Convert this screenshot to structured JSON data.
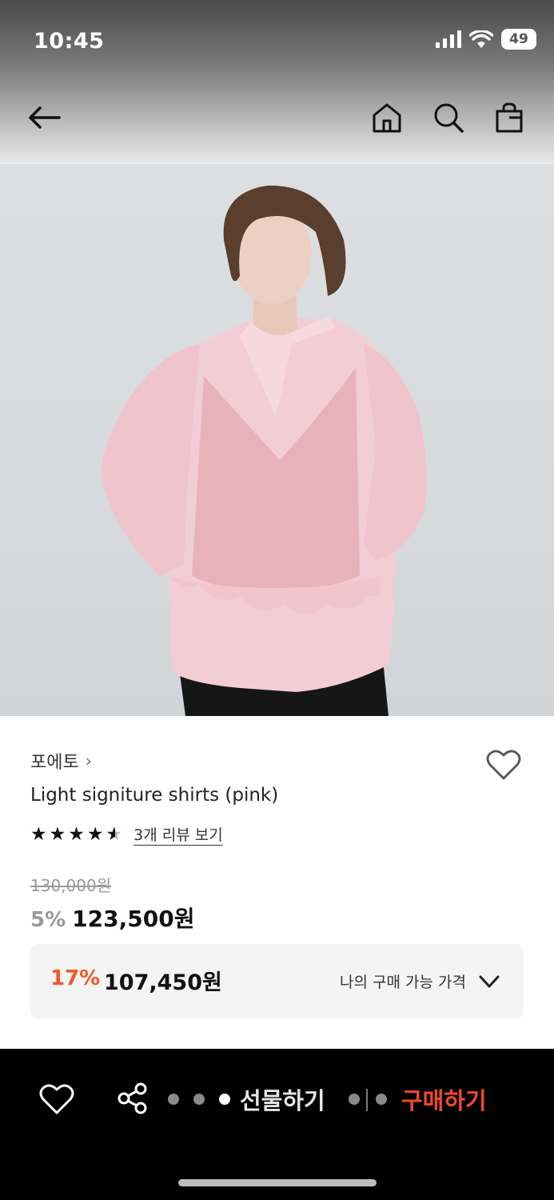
{
  "status_bar": {
    "time": "10:45",
    "battery": "49"
  },
  "nav": {
    "back_icon": "back-arrow-icon",
    "home_icon": "home-icon",
    "search_icon": "search-icon",
    "bag_icon": "shopping-bag-icon"
  },
  "product": {
    "brand": "포에토",
    "brand_chevron": "›",
    "name": "Light signiture shirts (pink)",
    "rating": 4.5,
    "stars": [
      "★",
      "★",
      "★",
      "★",
      "★"
    ],
    "review_link": "3개 리뷰 보기",
    "original_price": "130,000원",
    "discount": "5%",
    "price": "123,500원"
  },
  "my_price": {
    "percent": "17%",
    "amount": "107,450원",
    "label": "나의 구매 가능 가격"
  },
  "bottom_bar": {
    "gift_label": "선물하기",
    "buy_label": "구매하기"
  },
  "colors": {
    "accent": "#ef4a2b",
    "percent": "#ef5a28",
    "bar_bg": "#000000",
    "shirt_pink": "#f2c6cf"
  }
}
